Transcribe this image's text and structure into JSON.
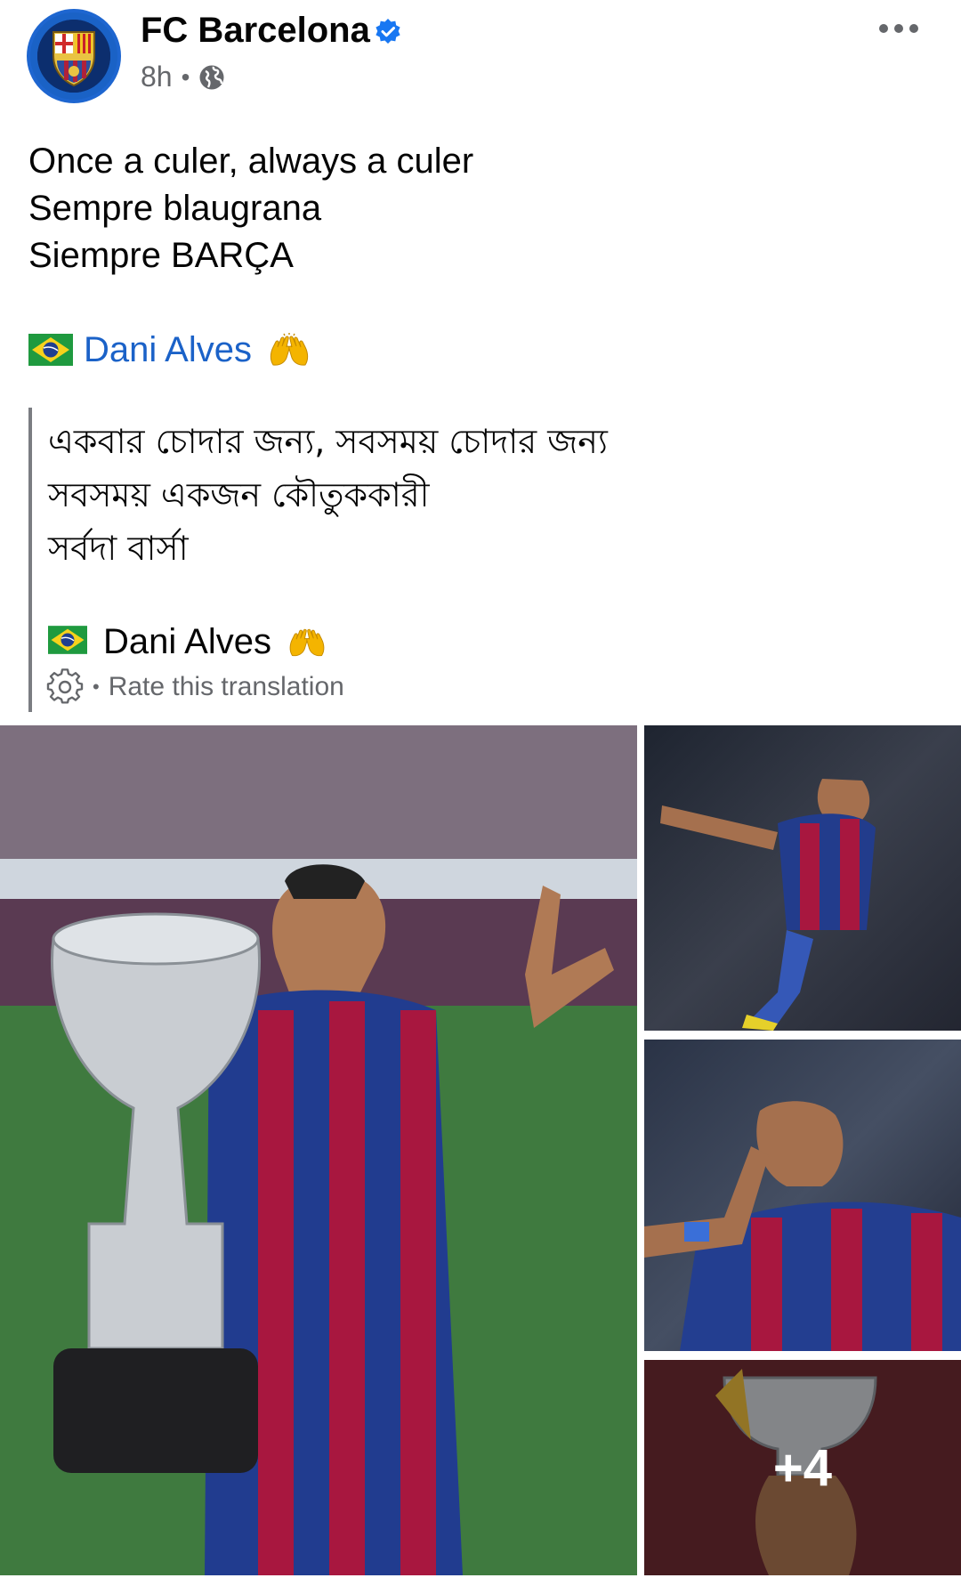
{
  "post": {
    "page_name": "FC Barcelona",
    "time": "8h",
    "separator": "•",
    "text_lines": [
      "Once a culer, always a culer",
      "Sempre blaugrana",
      "Siempre BARÇA"
    ],
    "mention": "Dani Alves",
    "mention_emoji": "raising-hands",
    "icons": {
      "verified": "verified-badge-icon",
      "audience": "globe-icon",
      "more": "more-options-icon",
      "flag": "brazil-flag-icon",
      "settings": "gear-icon"
    }
  },
  "translation": {
    "lines": [
      "একবার চোদার জন্য, সবসময় চোদার জন্য",
      "সবসময় একজন কৌতুককারী",
      "সর্বদা বার্সা"
    ],
    "mention": "Dani Alves",
    "separator": "•",
    "rate_label": "Rate this translation"
  },
  "gallery": {
    "more_count_label": "+4"
  },
  "colors": {
    "link": "#1b62c8",
    "secondary_text": "#65676b",
    "verified": "#1877f2"
  }
}
